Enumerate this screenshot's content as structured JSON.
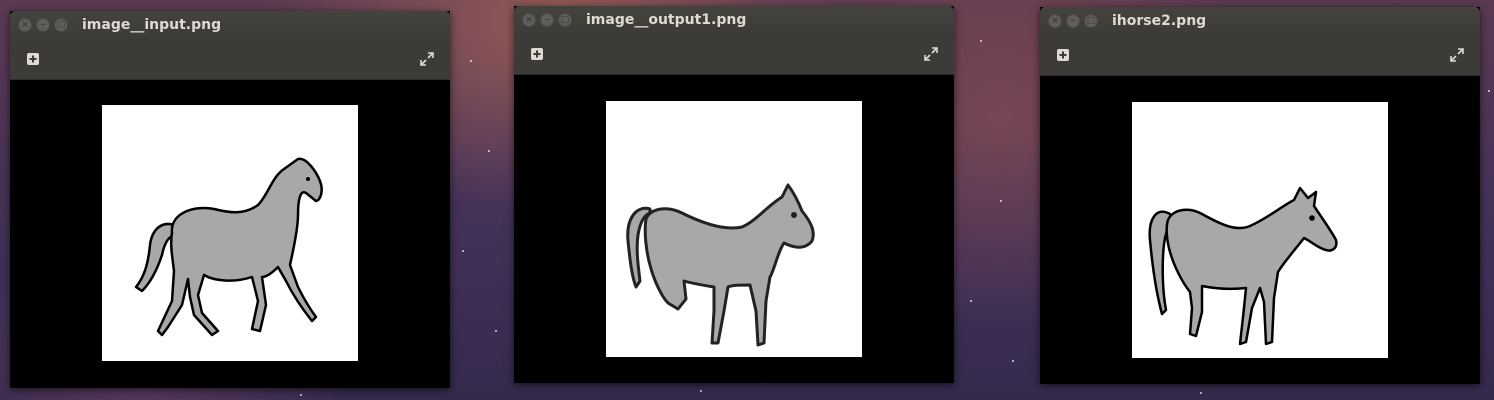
{
  "windows": [
    {
      "title": "image__input.png"
    },
    {
      "title": "image__output1.png"
    },
    {
      "title": "ihorse2.png"
    }
  ],
  "icons": {
    "close": "close-icon",
    "minimize": "minimize-icon",
    "maximize": "maximize-icon",
    "add": "add-icon",
    "fullscreen": "fullscreen-icon"
  },
  "colors": {
    "titlebar": "#3c3b37",
    "title_text": "#dfdbd2",
    "canvas": "#000000",
    "horse_fill": "#a8a8a8",
    "horse_outline": "#000000"
  }
}
